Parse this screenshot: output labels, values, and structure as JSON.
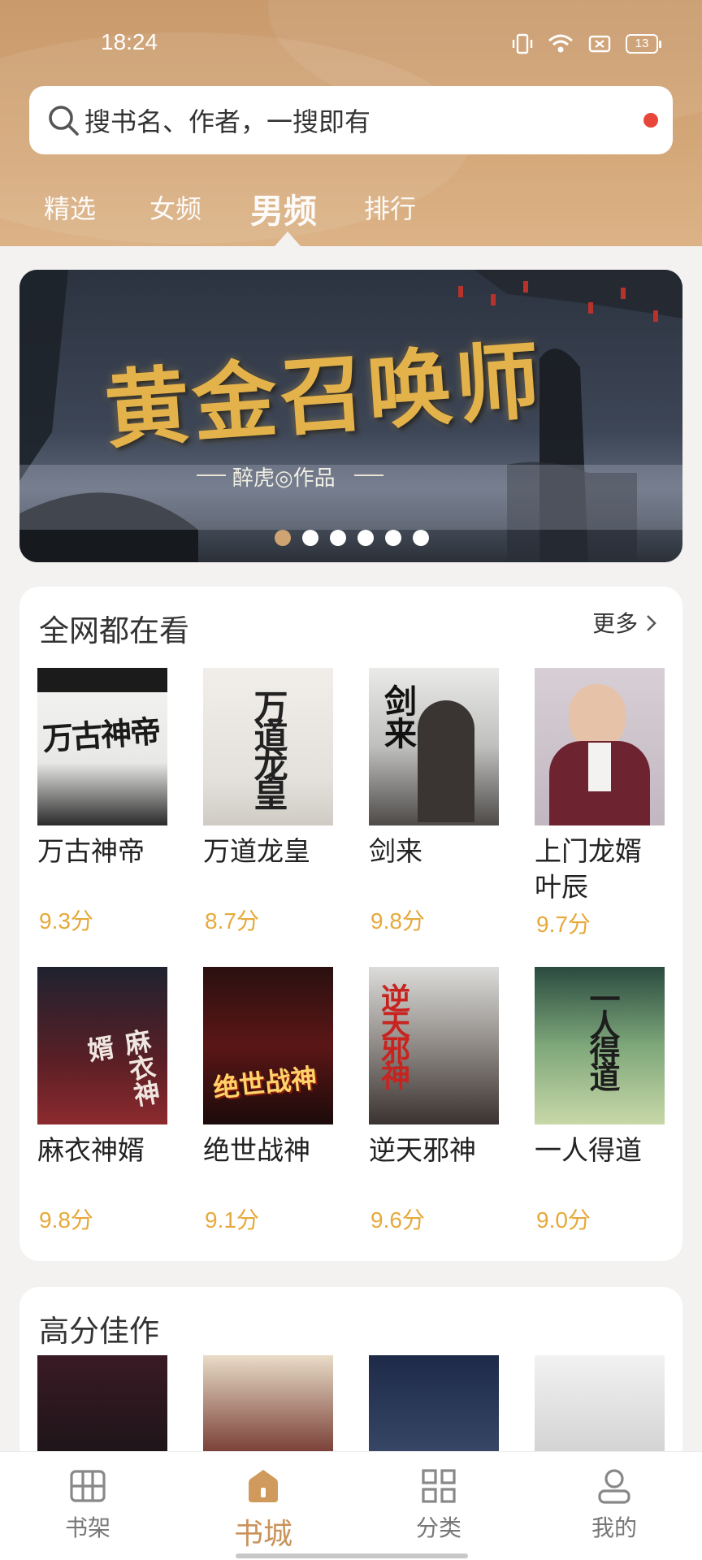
{
  "status_bar": {
    "time": "18:24",
    "battery": "13"
  },
  "search": {
    "placeholder": "搜书名、作者，一搜即有"
  },
  "tabs": [
    {
      "label": "精选"
    },
    {
      "label": "女频"
    },
    {
      "label": "男频",
      "active": true
    },
    {
      "label": "排行"
    }
  ],
  "banner": {
    "title": "黄金召唤师",
    "author": "醉虎◎作品",
    "page_count": 6,
    "active_page": 1
  },
  "section_hot": {
    "title": "全网都在看",
    "more": "更多",
    "books": [
      {
        "title": "万古神帝",
        "score": "9.3分",
        "cover_text": "万古神帝"
      },
      {
        "title": "万道龙皇",
        "score": "8.7分",
        "cover_text": "万道龙皇"
      },
      {
        "title": "剑来",
        "score": "9.8分",
        "cover_text": "剑来"
      },
      {
        "title": "上门龙婿叶辰",
        "score": "9.7分",
        "cover_text": ""
      },
      {
        "title": "麻衣神婿",
        "score": "9.8分",
        "cover_text": "麻衣神婿"
      },
      {
        "title": "绝世战神",
        "score": "9.1分",
        "cover_text": "绝世战神"
      },
      {
        "title": "逆天邪神",
        "score": "9.6分",
        "cover_text": "逆天邪神"
      },
      {
        "title": "一人得道",
        "score": "9.0分",
        "cover_text": "一人得道"
      }
    ]
  },
  "section_top": {
    "title": "高分佳作"
  },
  "bottom_nav": [
    {
      "label": "书架",
      "icon": "bookshelf-icon"
    },
    {
      "label": "书城",
      "icon": "home-icon",
      "active": true
    },
    {
      "label": "分类",
      "icon": "grid-icon"
    },
    {
      "label": "我的",
      "icon": "user-icon"
    }
  ],
  "colors": {
    "accent": "#c9935a",
    "score": "#e6a93a",
    "header": "#d3a677"
  }
}
